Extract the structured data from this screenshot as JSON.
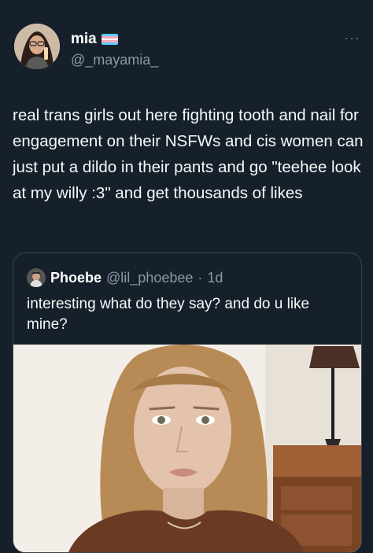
{
  "author": {
    "display_name": "mia",
    "handle": "@_mayamia_",
    "flag_icon": "trans-flag-icon",
    "flag_colors": [
      "#5bcefa",
      "#f5a9b8",
      "#ffffff",
      "#f5a9b8",
      "#5bcefa"
    ]
  },
  "more_label": "···",
  "tweet": {
    "text": "real trans girls out here fighting tooth and nail for engagement on their NSFWs and cis women can just put a dildo in their pants and go \"teehee look at my willy :3\" and get thousands of likes"
  },
  "quoted": {
    "display_name": "Phoebe",
    "handle": "@lil_phoebee",
    "separator": "·",
    "time": "1d",
    "text": "interesting what do they say? and do u like mine?"
  },
  "colors": {
    "background": "#15202b",
    "text": "#e7e9ea",
    "secondary": "#8b98a5",
    "border": "#38444d"
  }
}
